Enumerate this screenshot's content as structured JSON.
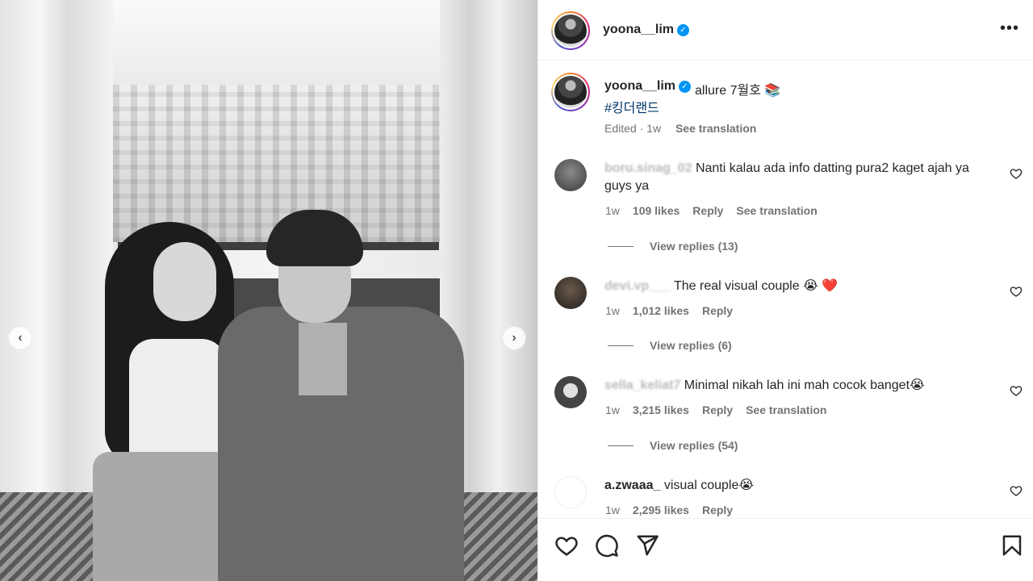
{
  "post": {
    "username": "yoona__lim",
    "caption": "allure 7월호 📚",
    "hashtag": "#킹더랜드",
    "edited": "Edited",
    "age": "1w",
    "see_translation": "See translation"
  },
  "photo": {
    "prev_label": "‹",
    "next_label": "›"
  },
  "comments": [
    {
      "username": "boru.sinag_02",
      "text": "Nanti kalau ada info datting pura2 kaget ajah ya guys ya",
      "age": "1w",
      "likes": "109 likes",
      "reply": "Reply",
      "translate": "See translation",
      "view_replies": "View replies (13)"
    },
    {
      "username": "devi.vp___",
      "text": "The real visual couple 😭 ❤️",
      "age": "1w",
      "likes": "1,012 likes",
      "reply": "Reply",
      "view_replies": "View replies (6)"
    },
    {
      "username": "sella_keliat7",
      "text": "Minimal nikah lah ini mah cocok banget😭",
      "age": "1w",
      "likes": "3,215 likes",
      "reply": "Reply",
      "translate": "See translation",
      "view_replies": "View replies (54)"
    },
    {
      "username": "a.zwaaa_",
      "text": "visual couple😭",
      "age": "1w",
      "likes": "2,295 likes",
      "reply": "Reply"
    }
  ],
  "icons": {
    "more": "more-options-icon",
    "verified": "verified-badge-icon",
    "like": "heart-icon",
    "comment": "comment-icon",
    "share": "share-icon",
    "save": "bookmark-icon"
  },
  "colors": {
    "link": "#00376b",
    "verified": "#0095f6",
    "muted": "#737373",
    "heart_red": "#ed4956"
  }
}
